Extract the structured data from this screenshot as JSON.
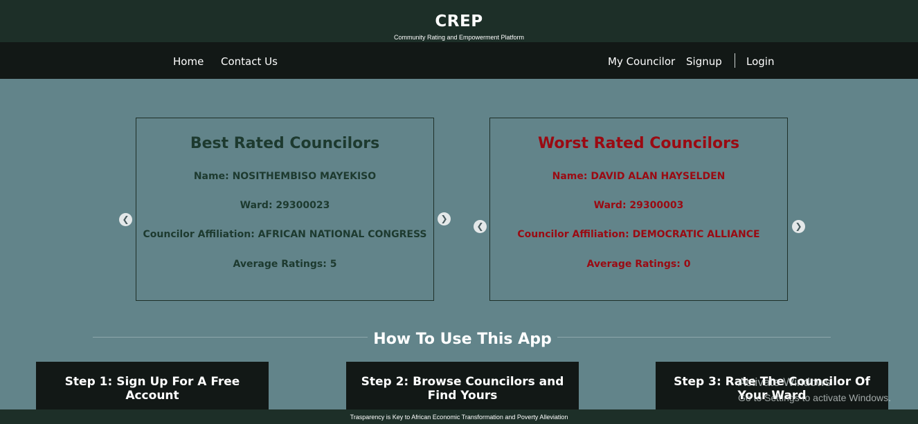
{
  "header": {
    "title": "CREP",
    "subtitle": "Community Rating and Empowerment Platform"
  },
  "nav": {
    "home": "Home",
    "contact": "Contact Us",
    "my_councilor": "My Councilor",
    "signup": "Signup",
    "login": "Login"
  },
  "best": {
    "title": "Best Rated Councilors",
    "name": "Name: NOSITHEMBISO MAYEKISO",
    "ward": "Ward: 29300023",
    "affiliation": "Councilor Affiliation: AFRICAN NATIONAL CONGRESS",
    "rating": "Average Ratings: 5"
  },
  "worst": {
    "title": "Worst Rated Councilors",
    "name": "Name: DAVID ALAN HAYSELDEN",
    "ward": "Ward: 29300003",
    "affiliation": "Councilor Affiliation: DEMOCRATIC ALLIANCE",
    "rating": "Average Ratings: 0"
  },
  "howto": {
    "title": "How To Use This App",
    "steps": [
      "Step 1: Sign Up For A Free Account",
      "Step 2: Browse Councilors and Find Yours",
      "Step 3: Rate The Councilor Of Your Ward"
    ]
  },
  "watermark": {
    "line1": "Activate Windows",
    "line2": "Go to Settings to activate Windows."
  },
  "footer": {
    "text": "Trasparency is Key to African Economic Transformation and Poverty Alleviation"
  },
  "icons": {
    "prev": "chevron-left-icon",
    "next": "chevron-right-icon"
  },
  "colors": {
    "header_bg": "#1d2f28",
    "nav_bg": "#121816",
    "page_bg": "#62848a",
    "best_text": "#1d3a2f",
    "worst_text": "#9a0a12"
  }
}
